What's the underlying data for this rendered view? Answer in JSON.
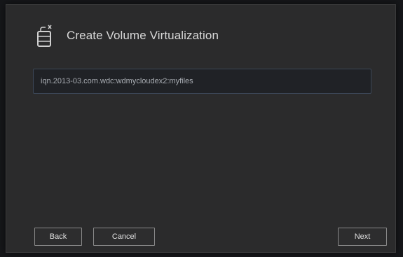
{
  "dialog": {
    "title": "Create Volume Virtualization",
    "icon": "volume-add-icon"
  },
  "iqn_field": {
    "value": "iqn.2013-03.com.wdc:wdmycloudex2:myfiles"
  },
  "buttons": {
    "back_label": "Back",
    "cancel_label": "Cancel",
    "next_label": "Next"
  }
}
